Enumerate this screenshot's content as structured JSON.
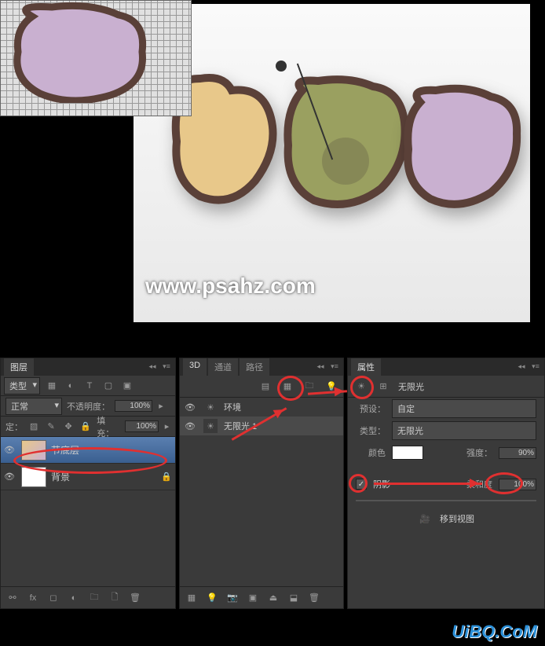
{
  "canvas": {
    "watermark": "www.psahz.com",
    "brand": "UiBQ.CoM"
  },
  "layers_panel": {
    "tab": "图层",
    "type_label": "类型",
    "blend_mode": "正常",
    "opacity_label": "不透明度：",
    "opacity_value": "100%",
    "lock_label": "定：",
    "fill_label": "填充：",
    "fill_value": "100%",
    "items": [
      {
        "name": "节底层"
      },
      {
        "name": "背景"
      }
    ]
  },
  "panel_3d": {
    "tabs": [
      "3D",
      "通道",
      "路径"
    ],
    "items": [
      {
        "name": "环境"
      },
      {
        "name": "无限光 1"
      }
    ]
  },
  "props_panel": {
    "tab": "属性",
    "title": "无限光",
    "preset_label": "预设：",
    "preset_value": "自定",
    "type_label": "类型：",
    "type_value": "无限光",
    "color_label": "颜色",
    "intensity_label": "强度：",
    "intensity_value": "90%",
    "shadow_label": "阴影",
    "softness_label": "柔和度",
    "softness_value": "100%",
    "move_view": "移到视图"
  }
}
